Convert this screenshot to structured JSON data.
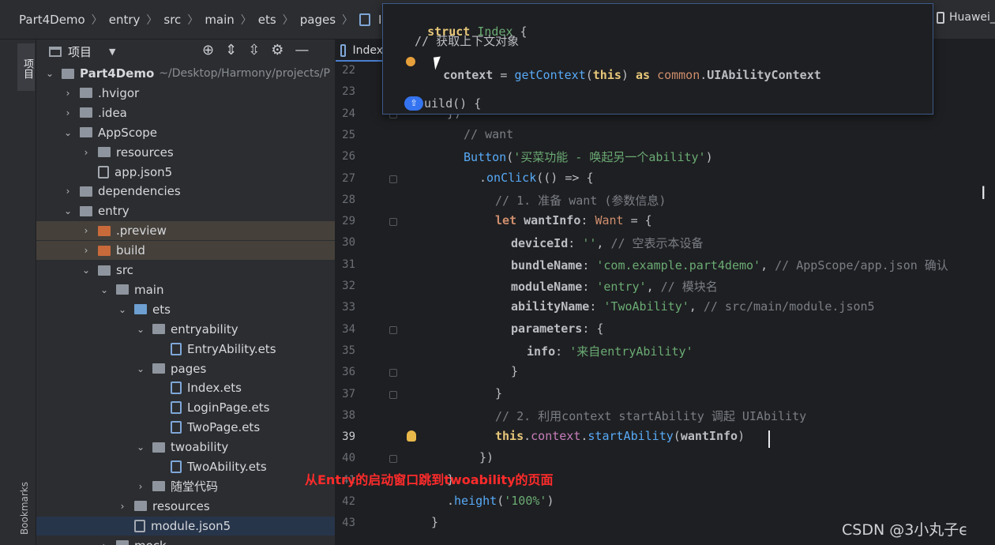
{
  "breadcrumb": [
    "Part4Demo",
    "entry",
    "src",
    "main",
    "ets",
    "pages",
    "Index.ets"
  ],
  "device_selector": "Huawei_",
  "tool_stripe": {
    "project_label": "项目",
    "bookmarks_label": "Bookmarks"
  },
  "panel": {
    "title": "项目"
  },
  "tree": [
    {
      "label": "Part4Demo",
      "path": "~/Desktop/Harmony/projects/P",
      "depth": 0,
      "chev": "v",
      "icon": "folder"
    },
    {
      "label": ".hvigor",
      "depth": 1,
      "chev": ">",
      "icon": "folder"
    },
    {
      "label": ".idea",
      "depth": 1,
      "chev": ">",
      "icon": "folder"
    },
    {
      "label": "AppScope",
      "depth": 1,
      "chev": "v",
      "icon": "folder"
    },
    {
      "label": "resources",
      "depth": 2,
      "chev": ">",
      "icon": "folder"
    },
    {
      "label": "app.json5",
      "depth": 2,
      "chev": "",
      "icon": "file-grey"
    },
    {
      "label": "dependencies",
      "depth": 1,
      "chev": ">",
      "icon": "folder"
    },
    {
      "label": "entry",
      "depth": 1,
      "chev": "v",
      "icon": "folder"
    },
    {
      "label": ".preview",
      "depth": 2,
      "chev": ">",
      "icon": "folder-orange",
      "hl": "brown"
    },
    {
      "label": "build",
      "depth": 2,
      "chev": ">",
      "icon": "folder-orange",
      "hl": "brown"
    },
    {
      "label": "src",
      "depth": 2,
      "chev": "v",
      "icon": "folder"
    },
    {
      "label": "main",
      "depth": 3,
      "chev": "v",
      "icon": "folder"
    },
    {
      "label": "ets",
      "depth": 4,
      "chev": "v",
      "icon": "folder-blue"
    },
    {
      "label": "entryability",
      "depth": 5,
      "chev": "v",
      "icon": "folder"
    },
    {
      "label": "EntryAbility.ets",
      "depth": 6,
      "chev": "",
      "icon": "file"
    },
    {
      "label": "pages",
      "depth": 5,
      "chev": "v",
      "icon": "folder"
    },
    {
      "label": "Index.ets",
      "depth": 6,
      "chev": "",
      "icon": "file"
    },
    {
      "label": "LoginPage.ets",
      "depth": 6,
      "chev": "",
      "icon": "file"
    },
    {
      "label": "TwoPage.ets",
      "depth": 6,
      "chev": "",
      "icon": "file"
    },
    {
      "label": "twoability",
      "depth": 5,
      "chev": "v",
      "icon": "folder"
    },
    {
      "label": "TwoAbility.ets",
      "depth": 6,
      "chev": "",
      "icon": "file"
    },
    {
      "label": "随堂代码",
      "depth": 5,
      "chev": ">",
      "icon": "folder"
    },
    {
      "label": "resources",
      "depth": 4,
      "chev": ">",
      "icon": "folder"
    },
    {
      "label": "module.json5",
      "depth": 4,
      "chev": "",
      "icon": "file-grey",
      "hl": "sel"
    },
    {
      "label": "mock",
      "depth": 3,
      "chev": ">",
      "icon": "folder"
    }
  ],
  "editor_tab": "Index",
  "popup": {
    "line1": "struct Index {",
    "line2": "// 获取上下文对象",
    "line3": "context = getContext(this) as common.UIAbilityContext",
    "line4": "uild() {"
  },
  "gutter": [
    "22",
    "23",
    "24",
    "25",
    "26",
    "27",
    "28",
    "29",
    "30",
    "31",
    "32",
    "33",
    "34",
    "35",
    "36",
    "37",
    "38",
    "39",
    "40",
    "41",
    "42",
    "43"
  ],
  "code": [
    {
      "ln": 24,
      "indent": 142,
      "html": "<span>})</span>"
    },
    {
      "ln": 25,
      "indent": 163,
      "html": "<span class='cmt'>// want</span>"
    },
    {
      "ln": 26,
      "indent": 163,
      "html": "<span class='fn'>Button</span>(<span class='str'>'买菜功能 - 唤起另一个ability'</span>)"
    },
    {
      "ln": 27,
      "indent": 183,
      "html": ".<span class='fn'>onClick</span>(() => {"
    },
    {
      "ln": 28,
      "indent": 203,
      "html": "<span class='cmt'>// 1. 准备 want (参数信息)</span>"
    },
    {
      "ln": 29,
      "indent": 203,
      "html": "<span class='kw'>let</span> <span class='prop'>wantInfo</span>: <span class='typ'>Want</span> = {"
    },
    {
      "ln": 30,
      "indent": 223,
      "html": "<span class='prop'>deviceId</span>: <span class='str'>''</span>, <span class='cmt'>// 空表示本设备</span>"
    },
    {
      "ln": 31,
      "indent": 223,
      "html": "<span class='prop'>bundleName</span>: <span class='str'>'com.example.part4demo'</span>, <span class='cmt'>// AppScope/app.json 确认</span>"
    },
    {
      "ln": 32,
      "indent": 223,
      "html": "<span class='prop'>moduleName</span>: <span class='str'>'entry'</span>, <span class='cmt'>// 模块名</span>"
    },
    {
      "ln": 33,
      "indent": 223,
      "html": "<span class='prop'>abilityName</span>: <span class='str'>'TwoAbility'</span>, <span class='cmt'>// src/main/module.json5</span>"
    },
    {
      "ln": 34,
      "indent": 223,
      "html": "<span class='prop'>parameters</span>: {"
    },
    {
      "ln": 35,
      "indent": 243,
      "html": "<span class='prop'>info</span>: <span class='str'>'来自entryAbility'</span>"
    },
    {
      "ln": 36,
      "indent": 223,
      "html": "}"
    },
    {
      "ln": 37,
      "indent": 203,
      "html": "}"
    },
    {
      "ln": 38,
      "indent": 203,
      "html": "<span class='cmt'>// 2. 利用context startAbility 调起 UIAbility</span>"
    },
    {
      "ln": 39,
      "indent": 203,
      "html": "<span class='kw2'>this</span>.<span class='purp'>context</span>.<span class='fn'>startAbility</span>(<span class='prop'>wantInfo</span>)"
    },
    {
      "ln": 40,
      "indent": 183,
      "html": "})"
    },
    {
      "ln": 41,
      "indent": 142,
      "html": "}"
    },
    {
      "ln": 42,
      "indent": 142,
      "html": ".<span class='fn'>height</span>(<span class='str'>'100%'</span>)"
    },
    {
      "ln": 43,
      "indent": 122,
      "html": "}"
    }
  ],
  "annotation": "从Entry的启动窗口跳到twoability的页面",
  "watermark": "CSDN @3小丸子ϵ"
}
